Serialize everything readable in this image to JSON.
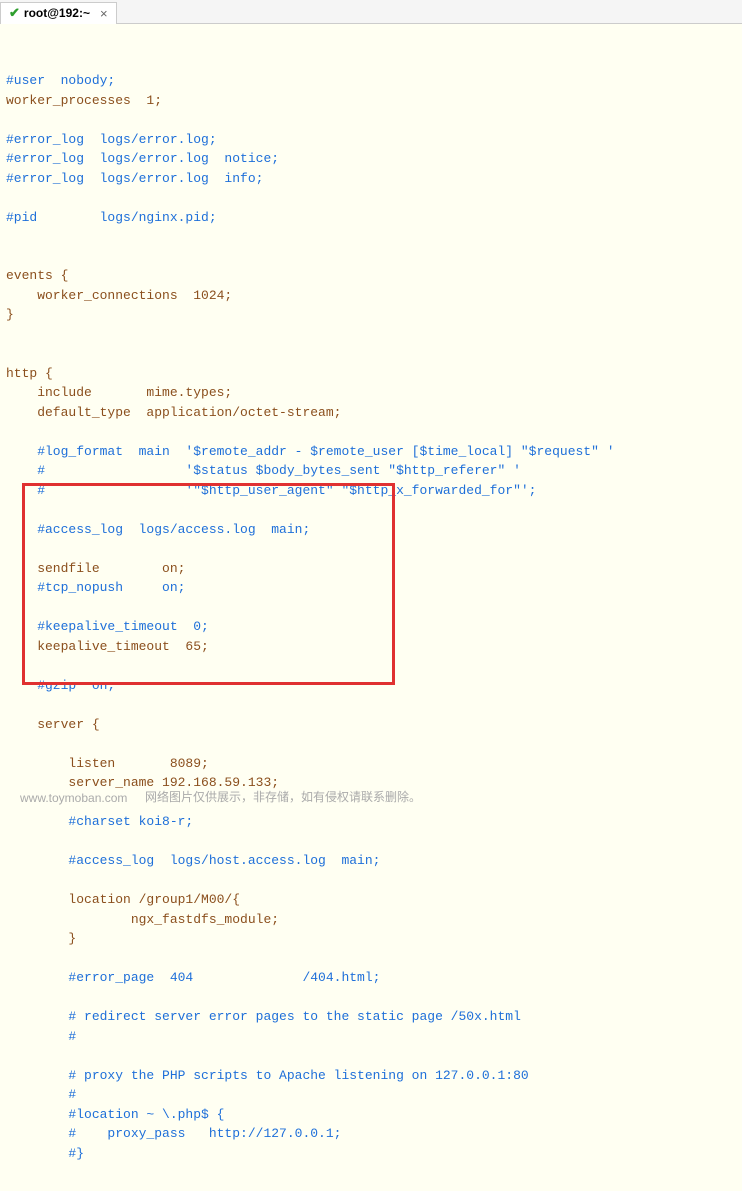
{
  "tab": {
    "title": "root@192:~",
    "close": "×"
  },
  "code": {
    "l1": "#user  nobody;",
    "l2": "worker_processes  1;",
    "l3": "#error_log  logs/error.log;",
    "l4": "#error_log  logs/error.log  notice;",
    "l5": "#error_log  logs/error.log  info;",
    "l6": "#pid        logs/nginx.pid;",
    "l7": "events {",
    "l8": "    worker_connections  1024;",
    "l9": "}",
    "l10": "http {",
    "l11": "    include       mime.types;",
    "l12": "    default_type  application/octet-stream;",
    "l13": "    #log_format  main  '$remote_addr - $remote_user [$time_local] \"$request\" '",
    "l14": "    #                  '$status $body_bytes_sent \"$http_referer\" '",
    "l15": "    #                  '\"$http_user_agent\" \"$http_x_forwarded_for\"';",
    "l16": "    #access_log  logs/access.log  main;",
    "l17": "    sendfile        on;",
    "l18": "    #tcp_nopush     on;",
    "l19": "    #keepalive_timeout  0;",
    "l20": "    keepalive_timeout  65;",
    "l21": "    #gzip  on;",
    "l22": "    server {",
    "l23": "        listen       8089;",
    "l24": "        server_name 192.168.59.133;",
    "l25": "        #charset koi8-r;",
    "l26": "        #access_log  logs/host.access.log  main;",
    "l27": "        location /group1/M00/{",
    "l28": "                ngx_fastdfs_module;",
    "l29": "        }",
    "l30": "        #error_page  404              /404.html;",
    "l31": "        # redirect server error pages to the static page /50x.html",
    "l32": "        #",
    "l33": "        # proxy the PHP scripts to Apache listening on 127.0.0.1:80",
    "l34": "        #",
    "l35": "        #location ~ \\.php$ {",
    "l36": "        #    proxy_pass   http://127.0.0.1;",
    "l37": "        #}"
  },
  "watermark": {
    "left": "www.toymoban.com",
    "right": "网络图片仅供展示，非存储，如有侵权请联系删除。"
  }
}
